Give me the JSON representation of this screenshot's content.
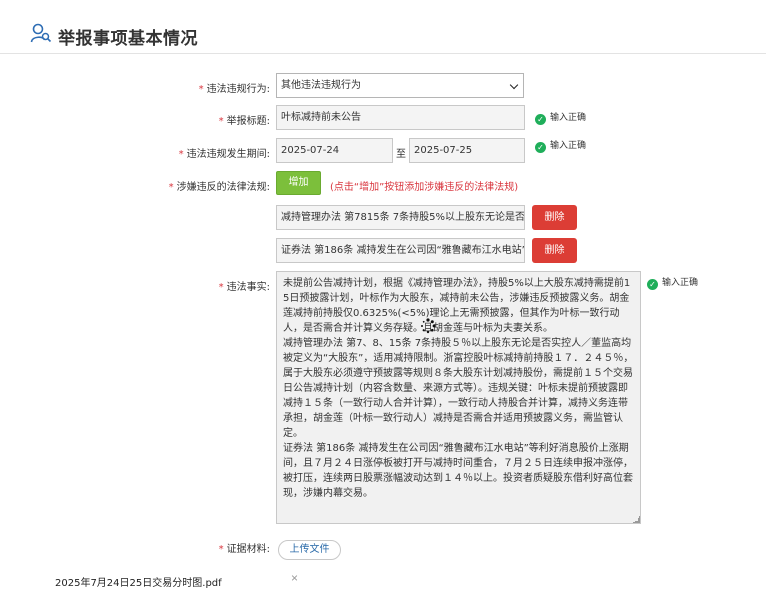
{
  "header": {
    "title": "举报事项基本情况",
    "icon": "user-search-icon"
  },
  "form": {
    "violation_type": {
      "label": "违法违规行为:",
      "value": "其他违法违规行为"
    },
    "report_title": {
      "label": "举报标题:",
      "value": "叶标减持前未公告",
      "status": "输入正确"
    },
    "period": {
      "label": "违法违规发生期间:",
      "start": "2025-07-24",
      "separator": "至",
      "end": "2025-07-25",
      "status": "输入正确"
    },
    "laws": {
      "label": "涉嫌违反的法律法规:",
      "add_label": "增加",
      "hint": "(点击“增加”按钮添加涉嫌违反的法律法规)",
      "items": [
        {
          "text": "减持管理办法 第7815条 7条持股5%以上股东无论是否实控人",
          "delete_label": "删除"
        },
        {
          "text": "证券法 第186条 减持发生在公司因“雅鲁藏布江水电站”等利好消息",
          "delete_label": "删除"
        }
      ]
    },
    "facts": {
      "label": "违法事实:",
      "value": "未提前公告减持计划，根据《减持管理办法》，持股5%以上大股东减持需提前15日预披露计划，叶标作为大股东，减持前未公告，涉嫌违反预披露义务。胡金莲减持前持股仅0.6325%(<5%)理论上无需预披露，但其作为叶标一致行动人，是否需合并计算义务存疑。且胡金莲与叶标为夫妻关系。\n减持管理办法 第7、8、15条 7条持股５％以上股东无论是否实控人／董监高均被定义为“大股东”，适用减持限制。浙富控股叶标减持前持股１７．２４５％，属于大股东必须遵守预披露等规则８条大股东计划减持股份，需提前１５个交易日公告减持计划（内容含数量、来源方式等）。违规关键：叶标未提前预披露即减持１５条（一致行动人合并计算），一致行动人持股合并计算，减持义务连带承担，胡金莲（叶标一致行动人）减持是否需合并适用预披露义务，需监管认定。\n证券法 第186条 减持发生在公司因“雅鲁藏布江水电站”等利好消息股价上涨期间，且７月２４日涨停板被打开与减持时间重合，７月２５日连续申报冲涨停，被打压，连续两日股票涨幅波动达到１４％以上。投资者质疑股东借利好高位套现，涉嫌内幕交易。",
      "status": "输入正确"
    },
    "evidence": {
      "label": "证据材料:",
      "upload_label": "上传文件",
      "file_name": "2025年7月24日25日交易分时图.pdf",
      "remove_symbol": "×"
    },
    "required_mark": "*"
  },
  "colors": {
    "required": "#d9363e",
    "add_button": "#7cbf3b",
    "delete_button": "#dc3d35",
    "success": "#1fae5a"
  }
}
